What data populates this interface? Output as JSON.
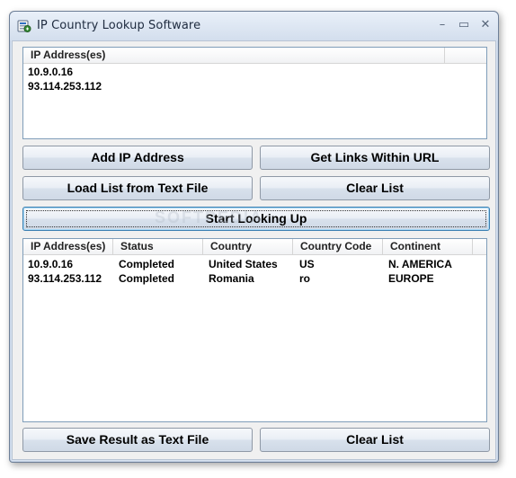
{
  "window": {
    "title": "IP Country Lookup Software",
    "minimize_glyph": "–",
    "maximize_glyph": "▭",
    "close_glyph": "✕"
  },
  "ip_list": {
    "header": "IP Address(es)",
    "items": [
      "10.9.0.16",
      "93.114.253.112"
    ]
  },
  "buttons": {
    "add_ip": "Add IP Address",
    "get_links": "Get Links Within URL",
    "load_list": "Load List from Text File",
    "clear_list_top": "Clear List",
    "start": "Start Looking Up",
    "save_result": "Save Result as Text File",
    "clear_list_bottom": "Clear List"
  },
  "results": {
    "columns": [
      "IP Address(es)",
      "Status",
      "Country",
      "Country Code",
      "Continent"
    ],
    "rows": [
      [
        "10.9.0.16",
        "Completed",
        "United States",
        "US",
        "N. AMERICA"
      ],
      [
        "93.114.253.112",
        "Completed",
        "Romania",
        "ro",
        "EUROPE"
      ]
    ]
  },
  "watermark": "SOFTPEDIA",
  "colors": {
    "title_bar": "#dbe5f2",
    "default_button_border": "#3c7fb1"
  },
  "icons": {
    "app": "ip-lookup-app-icon"
  }
}
